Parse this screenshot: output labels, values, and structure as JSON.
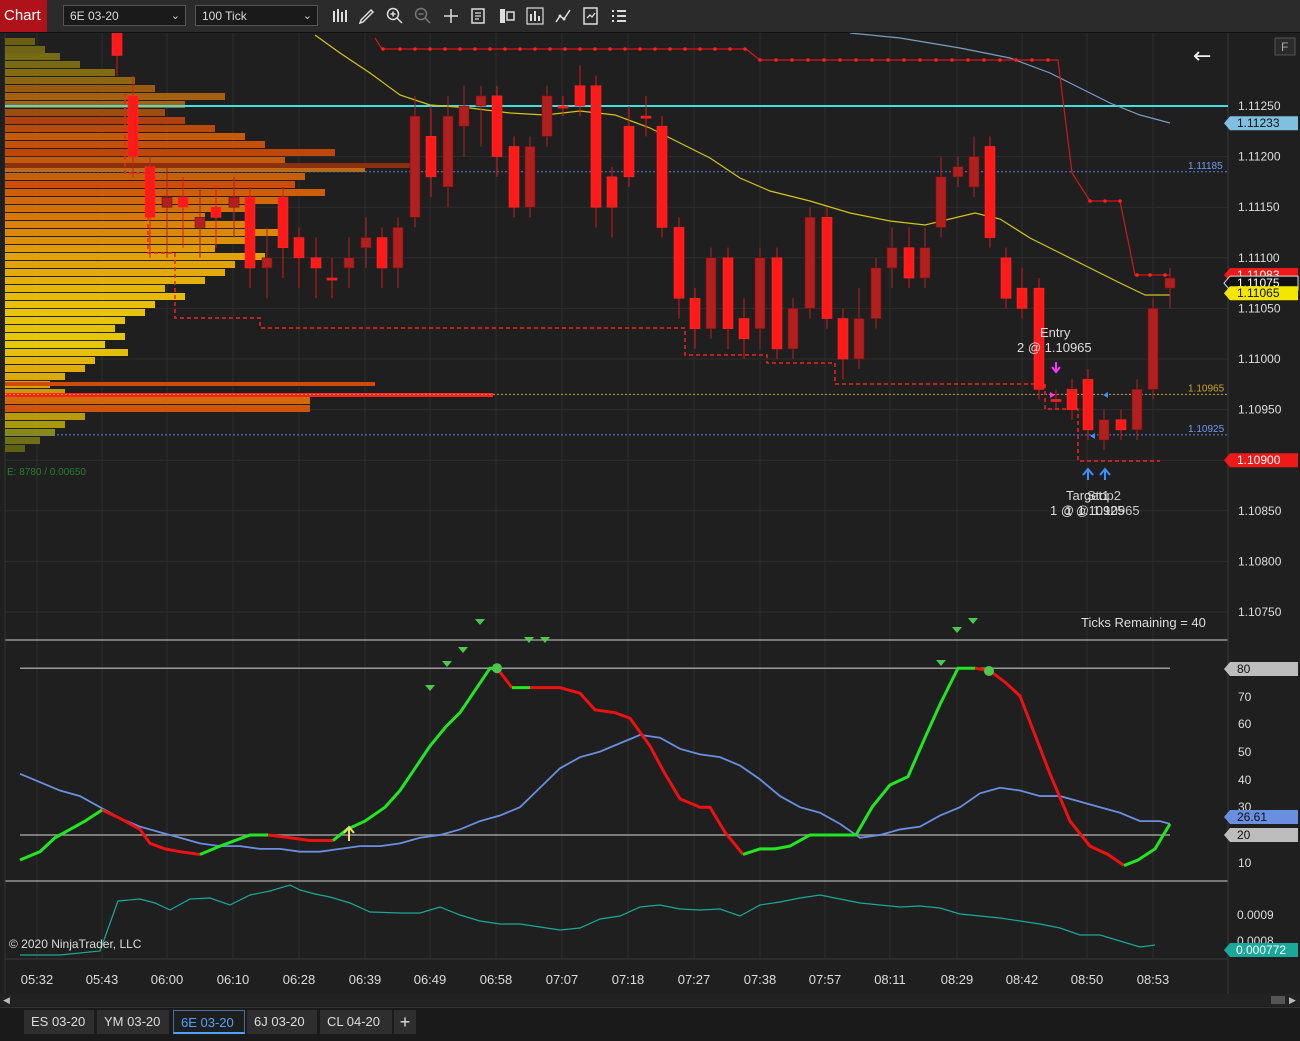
{
  "toolbar": {
    "chart_label": "Chart",
    "instrument": "6E 03-20",
    "interval": "100 Tick",
    "icons": [
      "bars-type-icon",
      "draw-pencil-icon",
      "zoom-in-icon",
      "zoom-out-icon",
      "crosshair-icon",
      "data-box-icon",
      "strategy-icon",
      "indicators-icon",
      "drawing-tools-icon",
      "templates-icon",
      "properties-icon"
    ]
  },
  "price_panel": {
    "price_ticks": [
      "1.11250",
      "1.11200",
      "1.11150",
      "1.11100",
      "1.11050",
      "1.11000",
      "1.10950",
      "1.10900",
      "1.10850",
      "1.10800",
      "1.10750"
    ],
    "marker_current": "1.11233",
    "marker_last": "1.11075",
    "marker_yellow": "1.11065",
    "marker_red_top": "1.11083",
    "marker_stop": "1.10900",
    "line_labels": {
      "upper_blue": "1.11185",
      "gold": "1.10965",
      "lower_blue": "1.10925"
    },
    "entry_label": "Entry",
    "entry_detail": "2 @ 1.10965",
    "target_label": "Target1",
    "target_detail": "1 @ 1.10925",
    "stop_label": "Stop2",
    "stop_detail": "1 @ 1.10965",
    "profile_info": "E: 8780 / 0.00650",
    "ticks_remaining": "Ticks Remaining = 40",
    "f_button": "F",
    "back_arrow": "←"
  },
  "osc_panel": {
    "ticks": [
      "70",
      "60",
      "50",
      "40",
      "30",
      "10"
    ],
    "marker_80": "80",
    "marker_20": "20",
    "marker_value": "26.61"
  },
  "third_panel": {
    "tick_a": "0.0009",
    "tick_b": "0.0008",
    "marker_value": "0.000772",
    "copyright": "© 2020 NinjaTrader, LLC"
  },
  "time_axis": [
    "05:32",
    "05:43",
    "06:00",
    "06:10",
    "06:28",
    "06:39",
    "06:49",
    "06:58",
    "07:07",
    "07:18",
    "07:27",
    "07:38",
    "07:57",
    "08:11",
    "08:29",
    "08:42",
    "08:50",
    "08:53"
  ],
  "tabs": [
    "ES 03-20",
    "YM 03-20",
    "6E 03-20",
    "6J 03-20",
    "CL 04-20"
  ],
  "active_tab": "6E 03-20",
  "colors": {
    "up_candle": "#b21f1f",
    "down_candle": "#ff1a1a",
    "accent_cyan": "#40e0e0",
    "osc_green": "#22e622",
    "osc_red": "#ee1111",
    "osc_blue": "#6a8fe0",
    "teal": "#1aa89a"
  }
}
